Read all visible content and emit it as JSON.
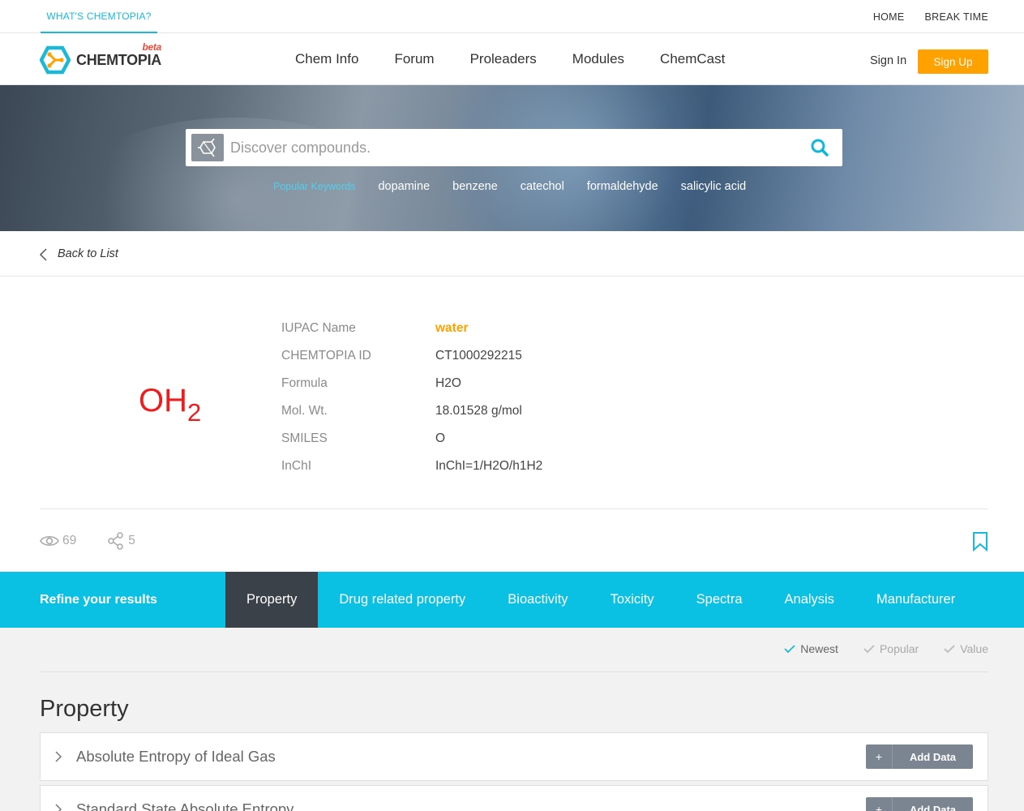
{
  "util_bar": {
    "whats": "WHAT'S CHEMTOPIA?",
    "links": [
      "HOME",
      "BREAK TIME"
    ]
  },
  "header": {
    "logo_text": "CHEMTOPIA",
    "logo_badge": "beta",
    "nav": [
      "Chem Info",
      "Forum",
      "Proleaders",
      "Modules",
      "ChemCast"
    ],
    "sign_in": "Sign In",
    "sign_up": "Sign Up",
    "accent_color": "#ffa200"
  },
  "search": {
    "placeholder": "Discover compounds.",
    "popular_label": "Popular Keywords",
    "keywords": [
      "dopamine",
      "benzene",
      "catechol",
      "formaldehyde",
      "salicylic acid"
    ]
  },
  "back": {
    "label": "Back to List"
  },
  "compound": {
    "structure_text": "OH",
    "structure_sub": "2",
    "fields": [
      {
        "key": "IUPAC Name",
        "value": "water"
      },
      {
        "key": "CHEMTOPIA ID",
        "value": "CT1000292215"
      },
      {
        "key": "Formula",
        "value": "H2O"
      },
      {
        "key": "Mol. Wt.",
        "value": "18.01528 g/mol"
      },
      {
        "key": "SMILES",
        "value": "O"
      },
      {
        "key": "InChI",
        "value": "InChI=1/H2O/h1H2"
      }
    ],
    "views": "69",
    "shares": "5"
  },
  "tabs": {
    "refine_label": "Refine your results",
    "items": [
      "Property",
      "Drug related property",
      "Bioactivity",
      "Toxicity",
      "Spectra",
      "Analysis",
      "Manufacturer"
    ],
    "active": "Property",
    "bar_color": "#0bc1e3"
  },
  "sort": {
    "options": [
      "Newest",
      "Popular",
      "Value"
    ],
    "active": "Newest"
  },
  "section": {
    "title": "Property",
    "cards": [
      {
        "title": "Absolute Entropy of Ideal Gas",
        "button": "Add Data"
      },
      {
        "title": "Standard State Absolute Entropy",
        "button": "Add Data"
      }
    ]
  }
}
